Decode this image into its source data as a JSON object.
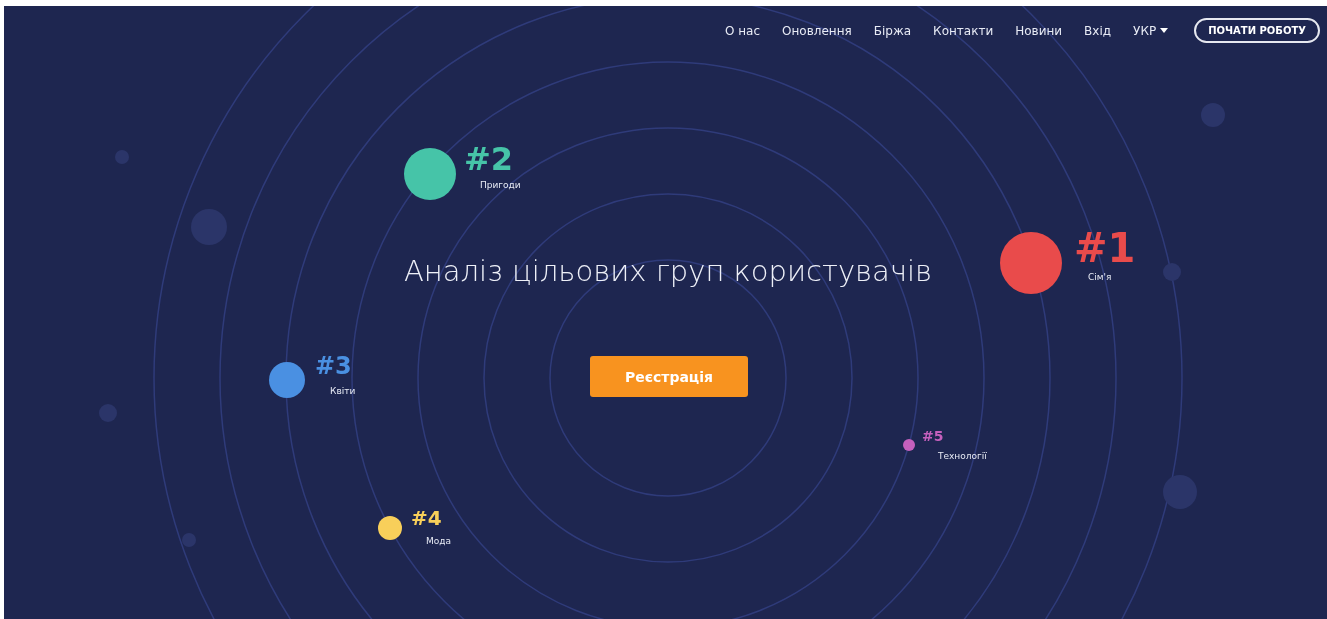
{
  "nav": {
    "links": [
      "О нас",
      "Оновлення",
      "Біржа",
      "Контакти",
      "Новини",
      "Вхід"
    ],
    "language": "УКР",
    "cta": "ПОЧАТИ РОБОТУ"
  },
  "hero": {
    "title": "Аналіз цільових груп користувачів",
    "button": "Реєстрація"
  },
  "groups": [
    {
      "rank": "#1",
      "label": "Сім'я",
      "color": "#e94b4b"
    },
    {
      "rank": "#2",
      "label": "Пригоди",
      "color": "#46c4a8"
    },
    {
      "rank": "#3",
      "label": "Квіти",
      "color": "#4a90e2"
    },
    {
      "rank": "#4",
      "label": "Мода",
      "color": "#f8cf5a"
    },
    {
      "rank": "#5",
      "label": "Технології",
      "color": "#c560bd"
    }
  ]
}
